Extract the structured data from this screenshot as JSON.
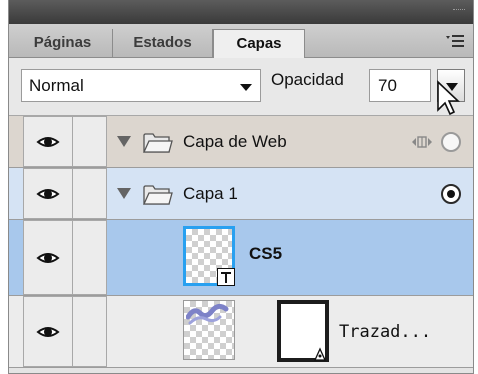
{
  "tabs": [
    {
      "label": "Páginas",
      "active": false
    },
    {
      "label": "Estados",
      "active": false
    },
    {
      "label": "Capas",
      "active": true
    }
  ],
  "blend_mode": {
    "value": "Normal"
  },
  "opacity": {
    "label": "Opacidad",
    "value": "70"
  },
  "layers": [
    {
      "name": "Capa de Web",
      "type": "folder",
      "expanded": true,
      "visible": true,
      "target_selected": false,
      "background": "#dcd6cf"
    },
    {
      "name": "Capa 1",
      "type": "folder",
      "expanded": true,
      "visible": true,
      "target_selected": true,
      "background": "#d5e3f4"
    },
    {
      "name": "CS5",
      "type": "text-object",
      "visible": true,
      "selected": true,
      "background": "#a8c8ec"
    },
    {
      "name": "Trazad...",
      "type": "path-object",
      "visible": true,
      "selected": false,
      "background": "#ececec"
    }
  ],
  "icons": {
    "eye": "eye-icon",
    "folder": "folder-icon",
    "panel_menu": "panel-menu-icon",
    "web_layer_share": "share-icon",
    "text_badge": "text-tool-icon"
  },
  "colors": {
    "selection_blue": "#a8c8ec",
    "row_blue": "#d5e3f4",
    "thumb_highlight": "#28a0f0"
  }
}
